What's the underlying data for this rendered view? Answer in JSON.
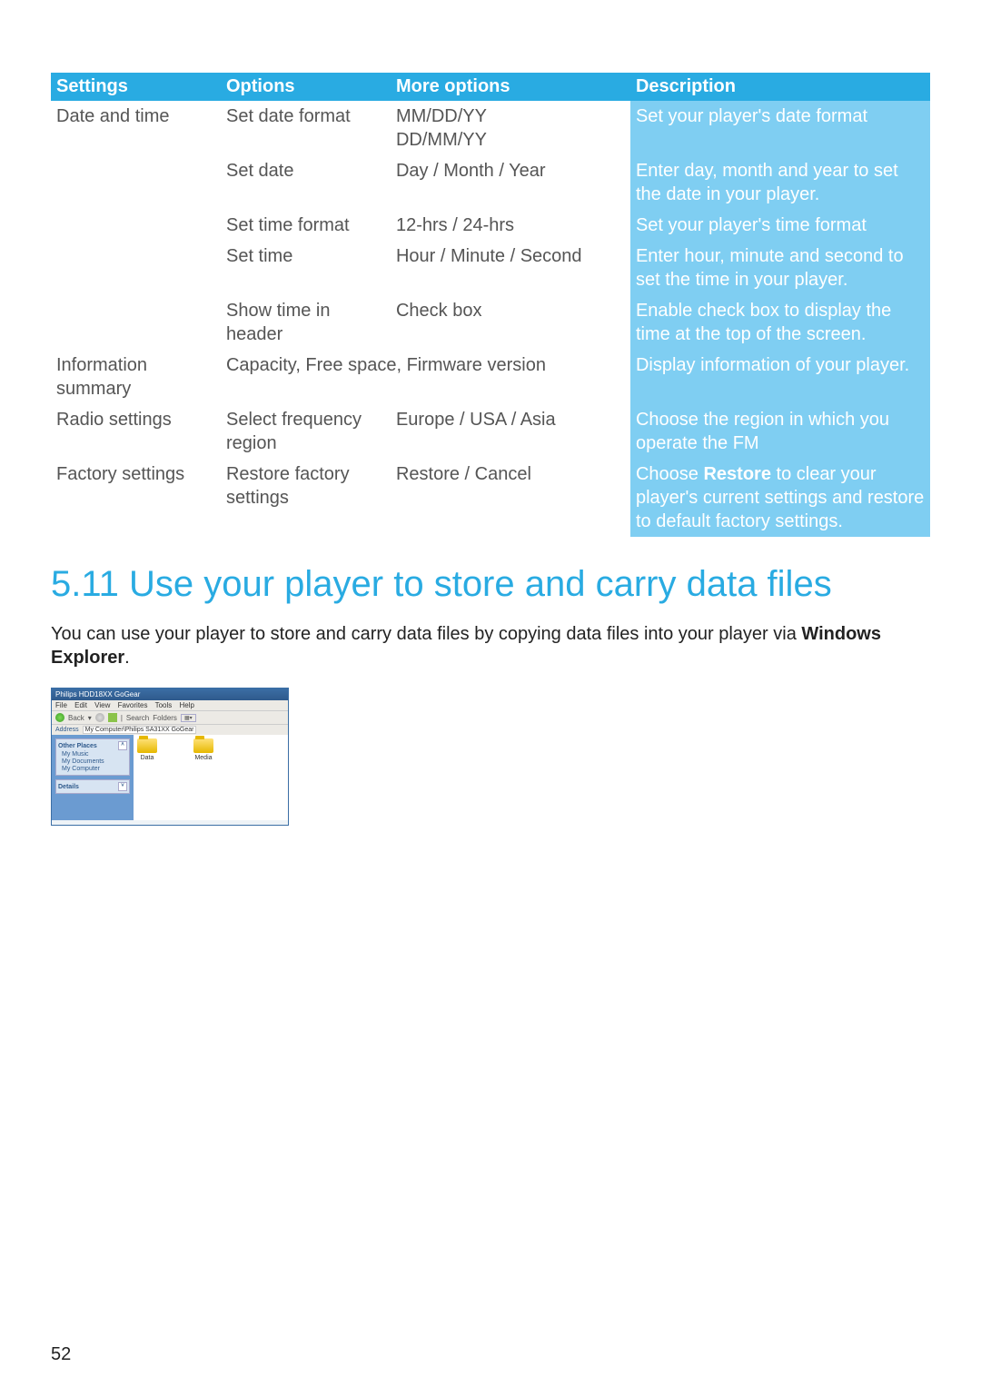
{
  "table": {
    "headers": [
      "Settings",
      "Options",
      "More options",
      "Description"
    ],
    "rows": [
      {
        "settings": "Date and time",
        "options": "Set date format",
        "more": "MM/DD/YY\nDD/MM/YY",
        "desc": "Set your player's date format"
      },
      {
        "settings": "",
        "options": "Set date",
        "more": "Day / Month / Year",
        "desc": "Enter day, month and year to set the date in your player."
      },
      {
        "settings": "",
        "options": "Set time format",
        "more": "12-hrs / 24-hrs",
        "desc": "Set your player's time format"
      },
      {
        "settings": "",
        "options": "Set time",
        "more": "Hour / Minute / Second",
        "desc": "Enter hour, minute and second to set the time in your player."
      },
      {
        "settings": "",
        "options": "Show time in header",
        "more": "Check box",
        "desc": "Enable check box to display the time at the top of the screen."
      },
      {
        "settings": "Information summary",
        "options_span": "Capacity, Free space, Firmware version",
        "desc": "Display information of your player."
      },
      {
        "settings": "Radio settings",
        "options": "Select frequency region",
        "more": "Europe / USA / Asia",
        "desc": "Choose the region in which you operate the FM"
      },
      {
        "settings": "Factory settings",
        "options": "Restore factory settings",
        "more": "Restore / Cancel",
        "desc_parts": [
          "Choose ",
          "Restore",
          " to clear your player's current settings and restore to default factory settings."
        ]
      }
    ]
  },
  "heading": "5.11 Use your player to store and carry data files",
  "body_parts": [
    "You can use your player to store and carry data files by copying data files into your player via ",
    "Windows Explorer",
    "."
  ],
  "explorer": {
    "title": "Philips HDD18XX GoGear",
    "menu": [
      "File",
      "Edit",
      "View",
      "Favorites",
      "Tools",
      "Help"
    ],
    "toolbar": {
      "back": "Back",
      "search": "Search",
      "folders": "Folders"
    },
    "address_label": "Address",
    "address": "My Computer\\Philips SA31XX GoGear",
    "panels": {
      "other_places": {
        "title": "Other Places",
        "items": [
          "My Music",
          "My Documents",
          "My Computer"
        ]
      },
      "details": {
        "title": "Details"
      }
    },
    "folders": [
      "Data",
      "Media"
    ]
  },
  "page_number": "52"
}
